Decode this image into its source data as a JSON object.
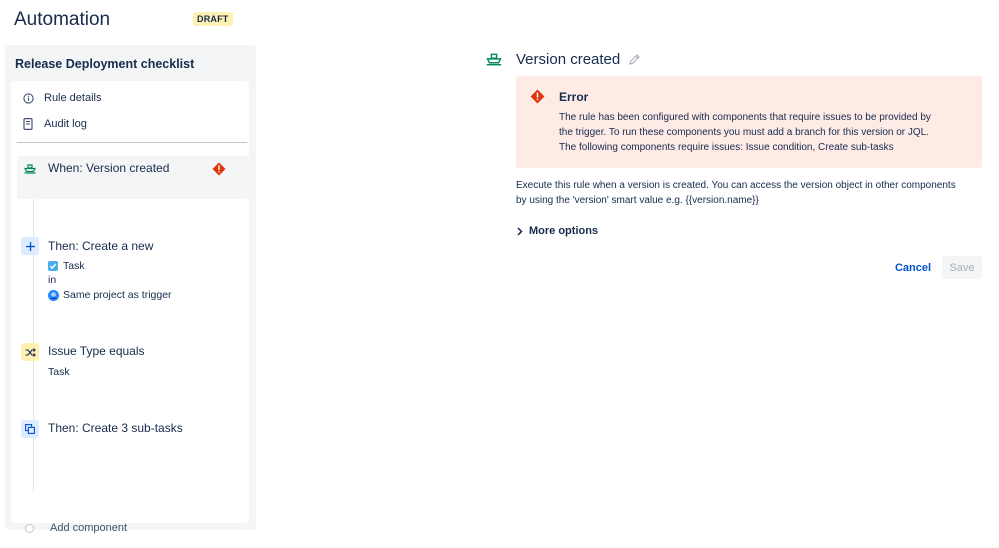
{
  "header": {
    "title": "Automation",
    "badge": "DRAFT"
  },
  "sidebar": {
    "rule_name": "Release Deployment checklist",
    "menu": [
      {
        "label": "Rule details",
        "icon": "info-icon"
      },
      {
        "label": "Audit log",
        "icon": "document-icon"
      }
    ],
    "steps": {
      "trigger": {
        "label": "When: Version created",
        "icon": "ship-icon",
        "status_icon": "error-icon"
      },
      "create": {
        "label": "Then: Create a new",
        "issue_type": "Task",
        "connector": "in",
        "project": "Same project as trigger"
      },
      "condition": {
        "label": "Issue Type equals",
        "value": "Task"
      },
      "subtasks": {
        "label": "Then: Create 3 sub-tasks"
      }
    },
    "add_component": "Add component"
  },
  "detail": {
    "title": "Version created",
    "error": {
      "title": "Error",
      "line1": "The rule has been configured with components that require issues to be provided by",
      "line2": "the trigger. To run these components you must add a branch for this version or JQL.",
      "line3": "The following components require issues: Issue condition, Create sub-tasks"
    },
    "description_line1": "Execute this rule when a version is created. You can access the version object in other components",
    "description_line2": "by using the 'version' smart value e.g. {{version.name}}",
    "more_options": "More options",
    "cancel": "Cancel",
    "save": "Save"
  },
  "colors": {
    "trigger_icon": "#00875a",
    "action_bg": "#deebff",
    "condition_bg": "#fff0b3",
    "error_bg": "#ffebe6",
    "error_red": "#de350b",
    "link_blue": "#0052cc"
  }
}
